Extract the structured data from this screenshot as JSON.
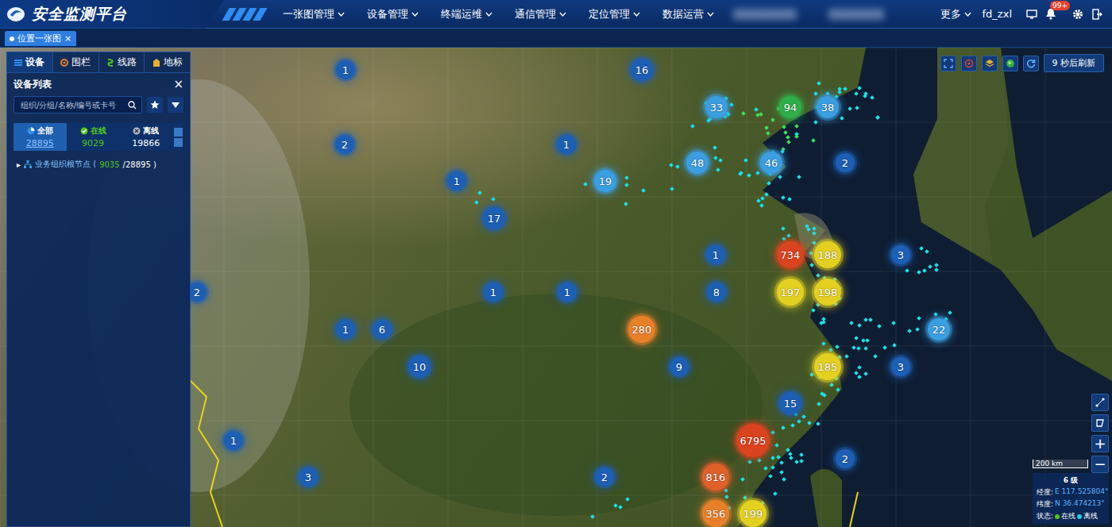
{
  "header": {
    "title": "安全监测平台",
    "nav": [
      {
        "label": "一张图管理"
      },
      {
        "label": "设备管理"
      },
      {
        "label": "终端运维"
      },
      {
        "label": "通信管理"
      },
      {
        "label": "定位管理"
      },
      {
        "label": "数据运营"
      }
    ],
    "more": "更多",
    "user": "fd_zxl",
    "badge": "99+"
  },
  "tabs": [
    {
      "label": "位置一张图",
      "selected": true,
      "close": "×"
    }
  ],
  "panel": {
    "tabs": [
      {
        "label": "设备",
        "selected": true,
        "color": "#2f8cf0"
      },
      {
        "label": "围栏",
        "selected": false,
        "color": "#e8802a"
      },
      {
        "label": "线路",
        "selected": false,
        "color": "#52c41a"
      },
      {
        "label": "地标",
        "selected": false,
        "color": "#e8b22a"
      }
    ],
    "title": "设备列表",
    "close": "×",
    "search": {
      "placeholder": "组织/分组/名称/编号或卡号"
    },
    "stats": [
      {
        "label": "全部",
        "value": "28895",
        "selected": true,
        "color": "#2f8cf0"
      },
      {
        "label": "在线",
        "value": "9029",
        "selected": false,
        "color": "#52c41a"
      },
      {
        "label": "离线",
        "value": "19866",
        "selected": false,
        "color": "#b0b8c4"
      }
    ],
    "tree": {
      "arrow": "▸",
      "expanded": false,
      "label": "业务组织根节点 (",
      "online": "9035",
      "rest": "/28895 )"
    }
  },
  "map": {
    "refresh": "9 秒后刷新",
    "clusters": [
      {
        "count": "1",
        "color": "#1d5fb5"
      },
      {
        "count": "16",
        "color": "#1d5fb5"
      },
      {
        "count": "33",
        "color": "#3a9ee0"
      },
      {
        "count": "94",
        "color": "#2fae4a"
      },
      {
        "count": "38",
        "color": "#3a9ee0"
      },
      {
        "count": "2",
        "color": "#1d5fb5"
      },
      {
        "count": "1",
        "color": "#1d5fb5"
      },
      {
        "count": "48",
        "color": "#3a9ee0"
      },
      {
        "count": "46",
        "color": "#3a9ee0"
      },
      {
        "count": "2",
        "color": "#1d5fb5"
      },
      {
        "count": "1",
        "color": "#1d5fb5"
      },
      {
        "count": "19",
        "color": "#3a9ee0"
      },
      {
        "count": "17",
        "color": "#1d5fb5"
      },
      {
        "count": "1",
        "color": "#1d5fb5"
      },
      {
        "count": "734",
        "color": "#d9441f"
      },
      {
        "count": "188",
        "color": "#e3d020"
      },
      {
        "count": "3",
        "color": "#1d5fb5"
      },
      {
        "count": "1",
        "color": "#1d5fb5"
      },
      {
        "count": "1",
        "color": "#1d5fb5"
      },
      {
        "count": "8",
        "color": "#1d5fb5"
      },
      {
        "count": "197",
        "color": "#e3d020"
      },
      {
        "count": "198",
        "color": "#e3d020"
      },
      {
        "count": "2",
        "color": "#1d5fb5"
      },
      {
        "count": "1",
        "color": "#1d5fb5"
      },
      {
        "count": "6",
        "color": "#1d5fb5"
      },
      {
        "count": "280",
        "color": "#e8802a"
      },
      {
        "count": "22",
        "color": "#3a9ee0"
      },
      {
        "count": "10",
        "color": "#1d5fb5"
      },
      {
        "count": "9",
        "color": "#1d5fb5"
      },
      {
        "count": "185",
        "color": "#e3d020"
      },
      {
        "count": "3",
        "color": "#1d5fb5"
      },
      {
        "count": "15",
        "color": "#1d5fb5"
      },
      {
        "count": "1",
        "color": "#1d5fb5"
      },
      {
        "count": "6795",
        "color": "#d9441f"
      },
      {
        "count": "2",
        "color": "#1d5fb5"
      },
      {
        "count": "3",
        "color": "#1d5fb5"
      },
      {
        "count": "2",
        "color": "#1d5fb5"
      },
      {
        "count": "816",
        "color": "#e0602a"
      },
      {
        "count": "356",
        "color": "#e8802a"
      },
      {
        "count": "199",
        "color": "#e3d020"
      }
    ],
    "zoom_in": "+",
    "zoom_out": "−",
    "scale": "200 km",
    "info": {
      "zoom": "6 级",
      "lng_label": "经度:",
      "lng": "E 117.525804°",
      "lat_label": "纬度:",
      "lat": "N 36.474213°",
      "status_label": "状态:",
      "legend": [
        {
          "label": "在线",
          "color": "#52c41a"
        },
        {
          "label": "离线",
          "color": "#1fd2e6"
        }
      ]
    }
  }
}
